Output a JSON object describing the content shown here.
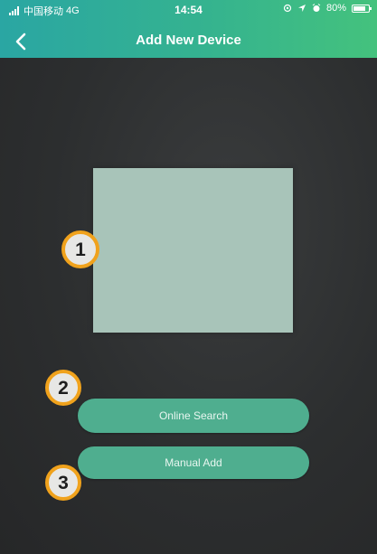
{
  "status_bar": {
    "carrier": "中国移动",
    "network": "4G",
    "time": "14:54",
    "battery": "80%",
    "battery_level": 0.8
  },
  "header": {
    "title": "Add New Device",
    "back_icon": "chevron-left-icon"
  },
  "preview": {
    "color": "#a8c4b9"
  },
  "buttons": {
    "online_search": "Online Search",
    "manual_add": "Manual Add"
  },
  "annotations": {
    "one": "1",
    "two": "2",
    "three": "3"
  },
  "colors": {
    "accent": "#4fae8f",
    "header_start": "#2aa6a3",
    "header_end": "#44c27d",
    "badge_ring": "#f0a21c"
  }
}
